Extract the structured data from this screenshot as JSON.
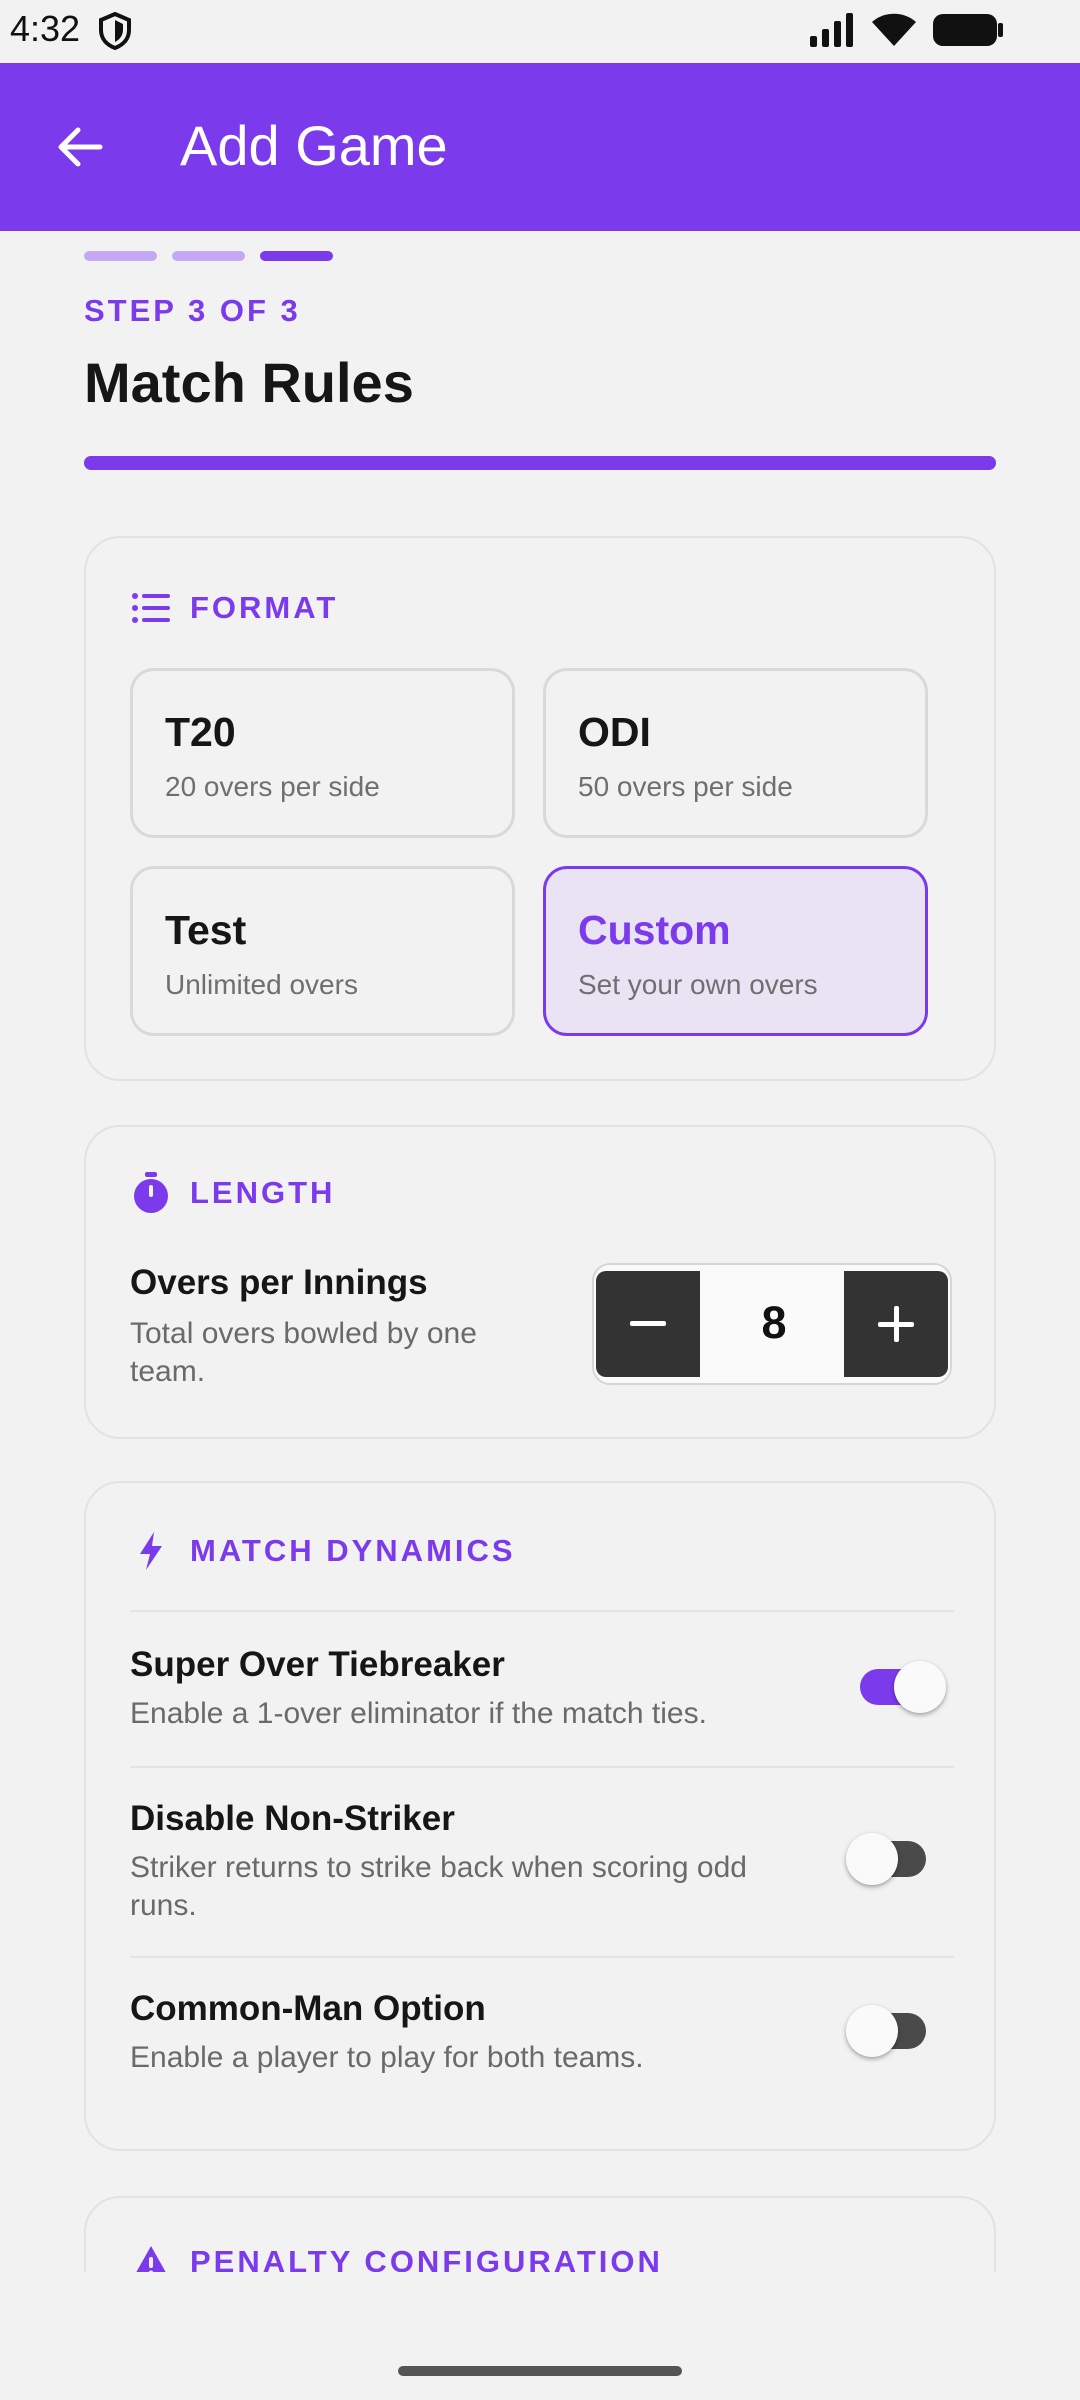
{
  "status": {
    "time": "4:32"
  },
  "app_bar": {
    "title": "Add Game"
  },
  "stepper_header": {
    "steps_total": 3,
    "current_step": 3,
    "step_label": "STEP 3 OF 3",
    "title": "Match Rules",
    "progress_fraction": 1.0
  },
  "format": {
    "title": "FORMAT",
    "options": [
      {
        "name": "T20",
        "sub": "20 overs per side",
        "selected": false
      },
      {
        "name": "ODI",
        "sub": "50 overs per side",
        "selected": false
      },
      {
        "name": "Test",
        "sub": "Unlimited overs",
        "selected": false
      },
      {
        "name": "Custom",
        "sub": "Set your own overs",
        "selected": true
      }
    ]
  },
  "length": {
    "title": "LENGTH",
    "overs_title": "Overs per Innings",
    "overs_sub": "Total overs bowled by one team.",
    "overs_value": "8"
  },
  "dynamics": {
    "title": "MATCH DYNAMICS",
    "rows": [
      {
        "title": "Super Over Tiebreaker",
        "sub": "Enable a 1-over eliminator if the match ties.",
        "on": true
      },
      {
        "title": "Disable Non-Striker",
        "sub": "Striker returns to strike back when scoring odd runs.",
        "on": false
      },
      {
        "title": "Common-Man Option",
        "sub": "Enable a player to play for both teams.",
        "on": false
      }
    ]
  },
  "penalty": {
    "title": "PENALTY CONFIGURATION"
  },
  "colors": {
    "accent": "#7c3aed",
    "selected_bg": "#e9e3f4",
    "stepper_btn": "#333333"
  }
}
